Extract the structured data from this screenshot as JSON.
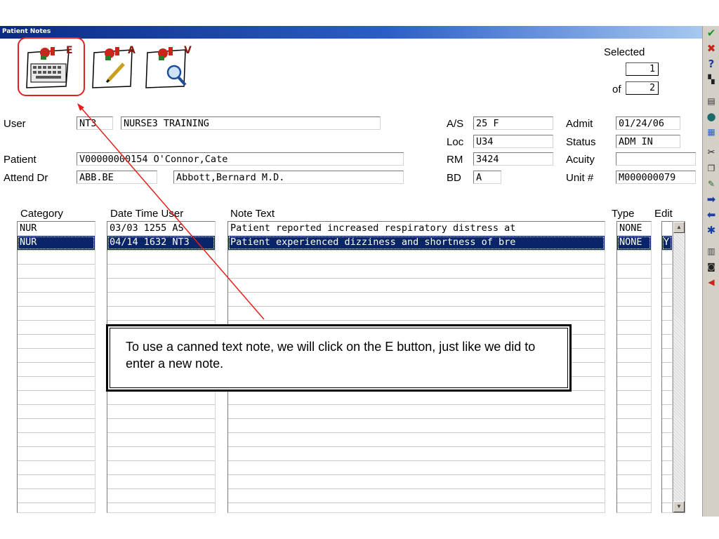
{
  "window": {
    "title": "Patient Notes"
  },
  "toolbar": {
    "enter_letter": "E",
    "add_letter": "A",
    "view_letter": "V"
  },
  "selection": {
    "selected_label": "Selected",
    "of_label": "of",
    "selected_value": "1",
    "total_value": "2"
  },
  "header": {
    "user_label": "User",
    "user_code": "NT3",
    "user_name": "NURSE3 TRAINING",
    "patient_label": "Patient",
    "patient_value": "V00000000154 O'Connor,Cate",
    "attend_label": "Attend Dr",
    "attend_code": "ABB.BE",
    "attend_name": "Abbott,Bernard M.D.",
    "as_label": "A/S",
    "as_value": "25 F",
    "loc_label": "Loc",
    "loc_value": "U34",
    "rm_label": "RM",
    "rm_value": "3424",
    "bd_label": "BD",
    "bd_value": "A",
    "admit_label": "Admit",
    "admit_value": "01/24/06",
    "status_label": "Status",
    "status_value": "ADM IN",
    "acuity_label": "Acuity",
    "acuity_value": "",
    "unit_label": "Unit #",
    "unit_value": "M000000079"
  },
  "grid": {
    "headers": {
      "category": "Category",
      "datetime": "Date Time User",
      "note": "Note Text",
      "type": "Type",
      "edit": "Edit"
    },
    "rows": [
      {
        "category": "NUR",
        "datetime": "03/03 1255  AS",
        "note": "Patient reported increased respiratory distress at",
        "type": "NONE",
        "edit": ""
      },
      {
        "category": "NUR",
        "datetime": "04/14 1632 NT3",
        "note": "Patient experienced dizziness and shortness of bre",
        "type": "NONE",
        "edit": "Y"
      }
    ]
  },
  "callout": {
    "text": "To use a canned text note, we will click on the E button, just like we did to enter a new note."
  },
  "colors": {
    "accent_red": "#e3201b",
    "selection": "#0a246a",
    "title_gradient_start": "#0b2a82"
  }
}
